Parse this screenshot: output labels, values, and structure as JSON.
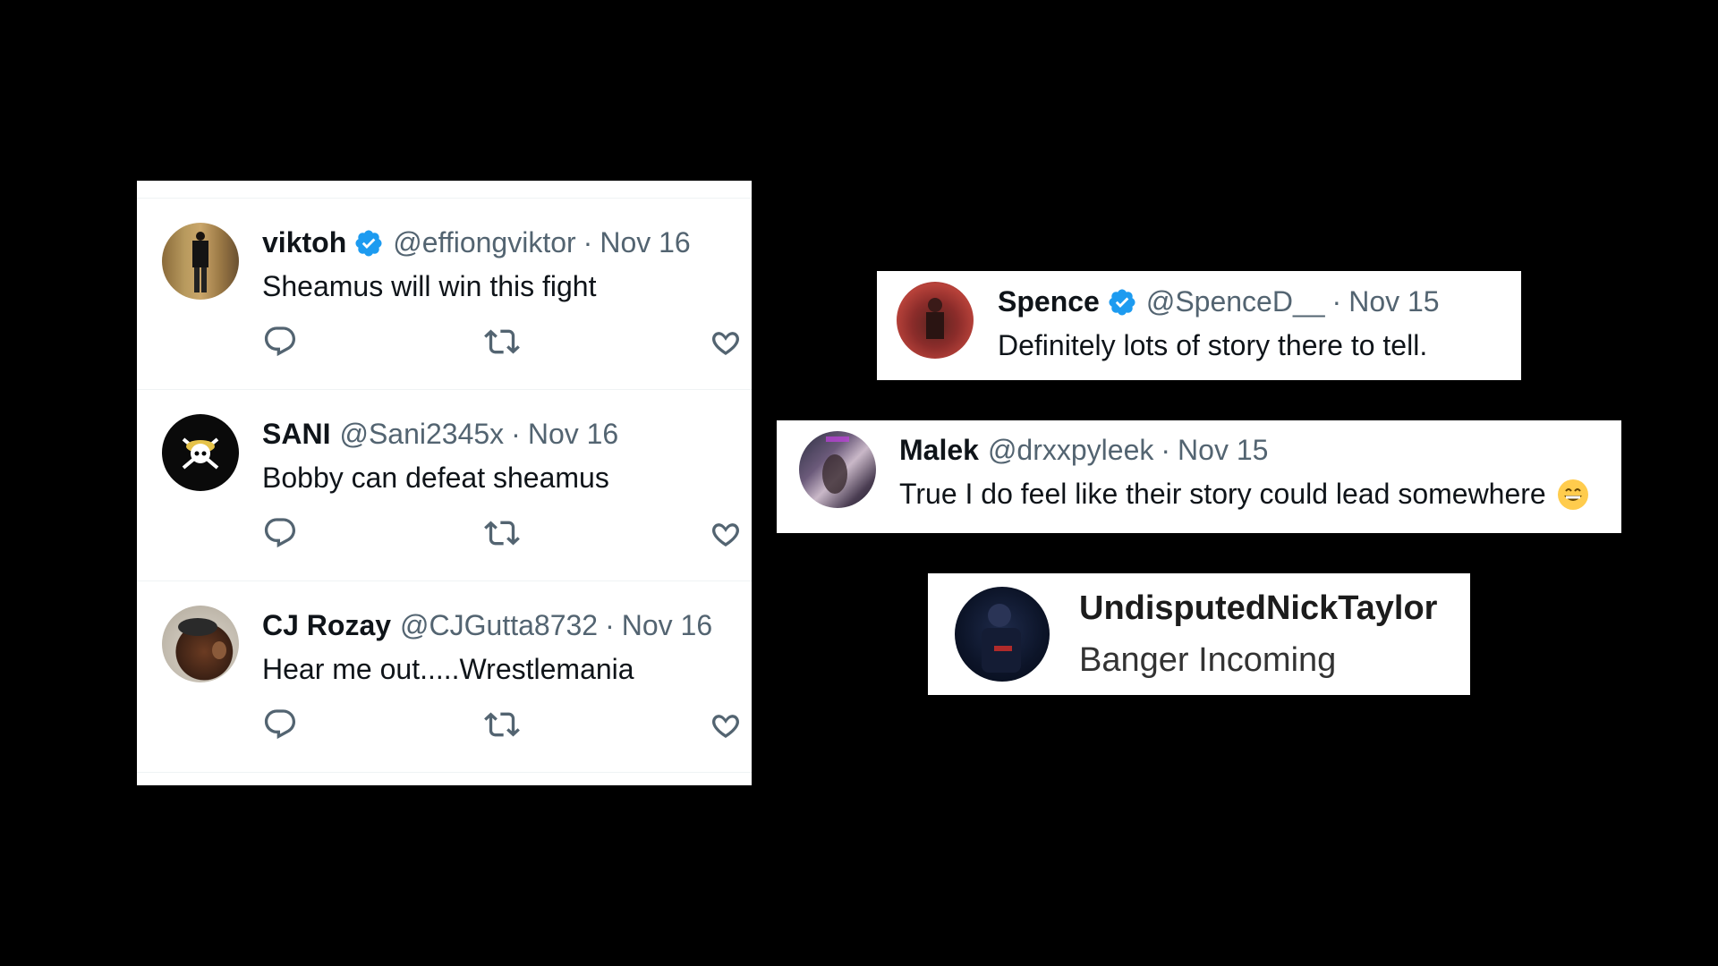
{
  "thread": {
    "tweets": [
      {
        "name": "viktoh",
        "verified": true,
        "handle": "@effiongviktor",
        "separator": "·",
        "date": "Nov 16",
        "text": "Sheamus will win this fight",
        "avatar": "person-avatar"
      },
      {
        "name": "SANI",
        "verified": false,
        "handle": "@Sani2345x",
        "separator": "·",
        "date": "Nov 16",
        "text": "Bobby can defeat sheamus",
        "avatar": "skull-crossbones-avatar"
      },
      {
        "name": "CJ Rozay",
        "verified": false,
        "handle": "@CJGutta8732",
        "separator": "·",
        "date": "Nov 16",
        "text": "Hear me out.....Wrestlemania",
        "avatar": "person-avatar"
      }
    ],
    "action_icons": [
      "reply-icon",
      "retweet-icon",
      "like-icon"
    ]
  },
  "spence": {
    "name": "Spence",
    "verified": true,
    "handle": "@SpenceD__",
    "separator": "·",
    "date": "Nov 15",
    "text": "Definitely lots of story there to tell."
  },
  "malek": {
    "name": "Malek",
    "verified": false,
    "handle": "@drxxpyleek",
    "separator": "·",
    "date": "Nov 15",
    "text": "True I do feel like their story could lead somewhere",
    "emoji": "grinning-face-emoji"
  },
  "nick": {
    "name": "UndisputedNickTaylor",
    "text": "Banger Incoming"
  },
  "colors": {
    "background": "#000000",
    "card": "#ffffff",
    "text_primary": "#0f1419",
    "text_secondary": "#536471",
    "verified_blue": "#1d9bf0",
    "divider": "#eff3f4"
  }
}
